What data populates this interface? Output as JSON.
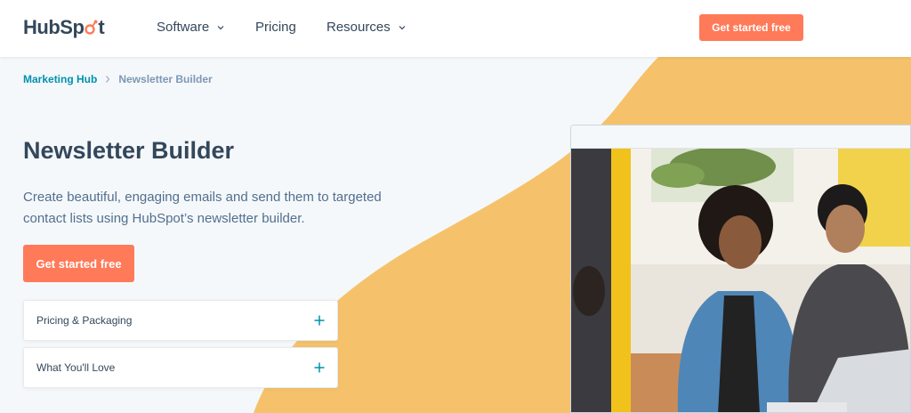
{
  "header": {
    "logo_text_prefix": "HubSp",
    "logo_text_o": "o",
    "logo_text_suffix": "t",
    "nav": [
      {
        "label": "Software",
        "has_dropdown": true
      },
      {
        "label": "Pricing",
        "has_dropdown": false
      },
      {
        "label": "Resources",
        "has_dropdown": true
      }
    ],
    "cta_label": "Get started free"
  },
  "breadcrumb": {
    "parent": "Marketing Hub",
    "current": "Newsletter Builder"
  },
  "hero": {
    "title": "Newsletter Builder",
    "description": "Create beautiful, engaging emails and send them to targeted contact lists using HubSpot’s newsletter builder.",
    "cta_label": "Get started free"
  },
  "accordions": [
    {
      "label": "Pricing & Packaging"
    },
    {
      "label": "What You'll Love"
    }
  ],
  "colors": {
    "accent": "#ff7a59",
    "link": "#0091ae",
    "blob": "#f5c26b",
    "text": "#33475b"
  },
  "icons": [
    "chevron-down-icon",
    "chevron-right-icon",
    "plus-icon",
    "sprocket-icon"
  ]
}
